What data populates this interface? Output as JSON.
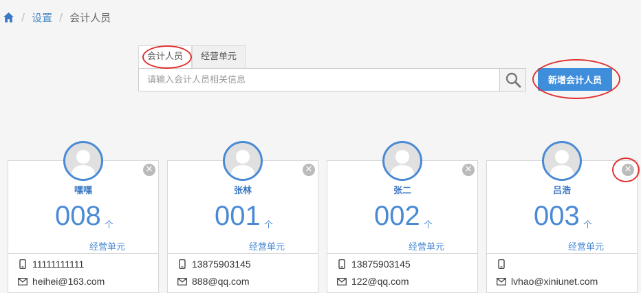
{
  "breadcrumb": {
    "items": [
      {
        "label": "设置"
      },
      {
        "label": "会计人员"
      }
    ]
  },
  "tabs": [
    {
      "label": "会计人员",
      "active": true
    },
    {
      "label": "经营单元",
      "active": false
    }
  ],
  "search": {
    "placeholder": "请输入会计人员相关信息",
    "value": ""
  },
  "add_button": {
    "label": "新增会计人员"
  },
  "cards": [
    {
      "name": "嘿嘿",
      "count": "008",
      "unit": "个",
      "unit_label": "经营单元",
      "phone": "11111111111",
      "email": "heihei@163.com"
    },
    {
      "name": "张林",
      "count": "001",
      "unit": "个",
      "unit_label": "经营单元",
      "phone": "13875903145",
      "email": "888@qq.com"
    },
    {
      "name": "张二",
      "count": "002",
      "unit": "个",
      "unit_label": "经营单元",
      "phone": "13875903145",
      "email": "122@qq.com"
    },
    {
      "name": "吕浩",
      "count": "003",
      "unit": "个",
      "unit_label": "经营单元",
      "phone": "",
      "email": "lvhao@xiniunet.com"
    }
  ],
  "colors": {
    "accent": "#4a8ad4",
    "button": "#3e8edc",
    "annotation": "#e03030"
  }
}
